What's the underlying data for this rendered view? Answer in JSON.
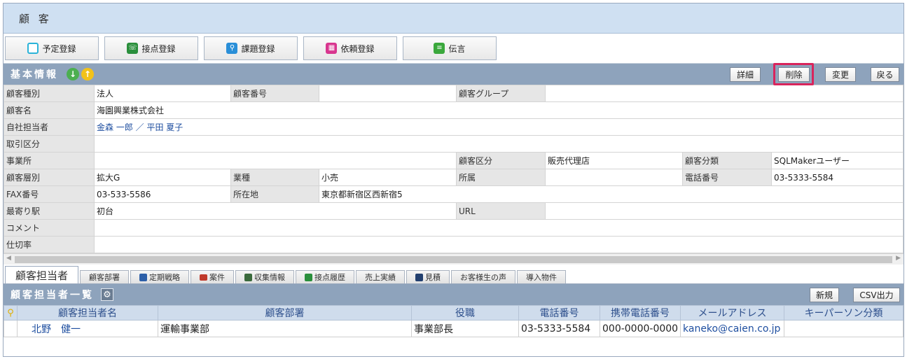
{
  "window": {
    "title": "顧 客"
  },
  "toolbar": {
    "buttons": [
      {
        "label": "予定登録",
        "icon": "clock-icon"
      },
      {
        "label": "接点登録",
        "icon": "contact-icon"
      },
      {
        "label": "課題登録",
        "icon": "pin-icon"
      },
      {
        "label": "依頼登録",
        "icon": "gift-icon"
      },
      {
        "label": "伝言",
        "icon": "memo-icon"
      }
    ]
  },
  "basic_info": {
    "title": "基本情報",
    "buttons": {
      "detail": "詳細",
      "delete": "削除",
      "change": "変更",
      "back": "戻る"
    },
    "highlight_color": "#d9245c"
  },
  "fields": {
    "customer_type_label": "顧客種別",
    "customer_type": "法人",
    "customer_no_label": "顧客番号",
    "customer_no": "",
    "customer_group_label": "顧客グループ",
    "customer_group": "",
    "customer_name_label": "顧客名",
    "customer_name": "海園興業株式会社",
    "staff_label": "自社担当者",
    "staff": "金森 一郎 ／ 平田 夏子",
    "trade_type_label": "取引区分",
    "trade_type": "",
    "office_label": "事業所",
    "office": "",
    "customer_class_label": "顧客区分",
    "customer_class": "販売代理店",
    "customer_category_label": "顧客分類",
    "customer_category": "SQLMakerユーザー",
    "customer_tier_label": "顧客層別",
    "customer_tier": "拡大G",
    "industry_label": "業種",
    "industry": "小売",
    "affiliation_label": "所属",
    "affiliation": "",
    "phone_label": "電話番号",
    "phone": "03-5333-5584",
    "fax_label": "FAX番号",
    "fax": "03-533-5586",
    "address_label": "所在地",
    "address": "東京都新宿区西新宿5",
    "station_label": "最寄り駅",
    "station": "初台",
    "url_label": "URL",
    "url": "",
    "comment_label": "コメント",
    "comment": "",
    "rate_label": "仕切率",
    "rate": ""
  },
  "tabs": [
    {
      "label": "顧客担当者",
      "active": true
    },
    {
      "label": "顧客部署"
    },
    {
      "label": "定期戦略",
      "icon": "strategy-icon"
    },
    {
      "label": "案件",
      "icon": "case-icon"
    },
    {
      "label": "収集情報",
      "icon": "collect-icon"
    },
    {
      "label": "接点履歴",
      "icon": "contact-history-icon"
    },
    {
      "label": "売上実績"
    },
    {
      "label": "見積",
      "icon": "estimate-icon"
    },
    {
      "label": "お客様生の声"
    },
    {
      "label": "導入物件"
    }
  ],
  "contact_list": {
    "title": "顧客担当者一覧",
    "buttons": {
      "new": "新規",
      "csv": "CSV出力"
    },
    "columns": [
      "顧客担当者名",
      "顧客部署",
      "役職",
      "電話番号",
      "携帯電話番号",
      "メールアドレス",
      "キーパーソン分類"
    ],
    "rows": [
      {
        "name": "北野　健一",
        "dept": "運輸事業部",
        "title": "事業部長",
        "phone": "03-5333-5584",
        "mobile": "000-0000-0000",
        "email": "kaneko@caien.co.jp",
        "keyperson": ""
      }
    ]
  }
}
